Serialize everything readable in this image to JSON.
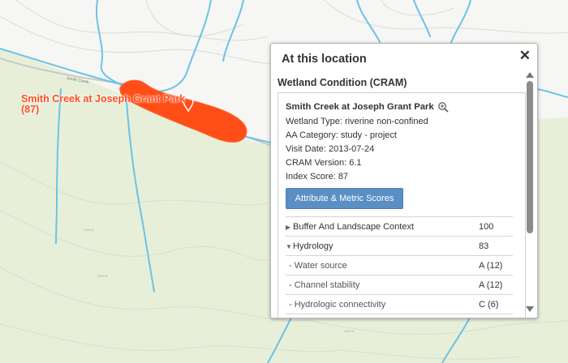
{
  "map": {
    "feature_label": "Smith Creek at Joseph Grant Park",
    "feature_count": "(87)",
    "road_label": "Smith Creek",
    "colors": {
      "land_white": "#f7f7f5",
      "land_green": "#e6efd9",
      "stream": "#6cc3e6",
      "wetland": "#ff4e17"
    }
  },
  "popup": {
    "title": "At this location",
    "close_label": "✕",
    "section_title": "Wetland Condition (CRAM)",
    "site_name": "Smith Creek at Joseph Grant Park",
    "wetland_type": "Wetland Type: riverine non-confined",
    "aa_category": "AA Category: study - project",
    "visit_date": "Visit Date: 2013-07-24",
    "cram_version": "CRAM Version: 6.1",
    "index_score": "Index Score: 87",
    "button_label": "Attribute & Metric Scores",
    "scores": [
      {
        "label": "Buffer And Landscape Context",
        "value": "100",
        "expander": "right"
      },
      {
        "label": "Hydrology",
        "value": "83",
        "expander": "down"
      },
      {
        "label": "- Water source",
        "value": "A (12)",
        "expander": "none"
      },
      {
        "label": "- Channel stability",
        "value": "A (12)",
        "expander": "none"
      },
      {
        "label": "- Hydrologic connectivity",
        "value": "C (6)",
        "expander": "none"
      }
    ]
  }
}
